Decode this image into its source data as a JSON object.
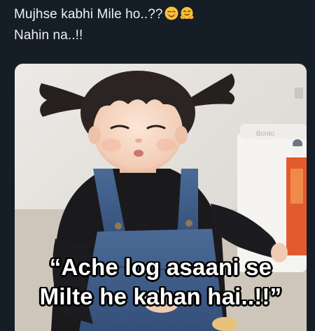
{
  "post": {
    "line1": "Mujhse kabhi Mile ho..??",
    "line2": "Nahin na..!!",
    "emojis": [
      "smiling-face-icon",
      "hugging-face-icon"
    ]
  },
  "image": {
    "caption_line1": "“Ache log asaani se",
    "caption_line2": "Milte he kahan hai..!!”",
    "sink_brand": "Bonto"
  },
  "colors": {
    "background": "#151d26",
    "post_text": "#eef1f4",
    "caption_fill": "#ffffff",
    "caption_outline": "#000000",
    "dungaree": "#3f5c86",
    "shirt": "#1a1a1d",
    "wall": "#e4e2de"
  }
}
